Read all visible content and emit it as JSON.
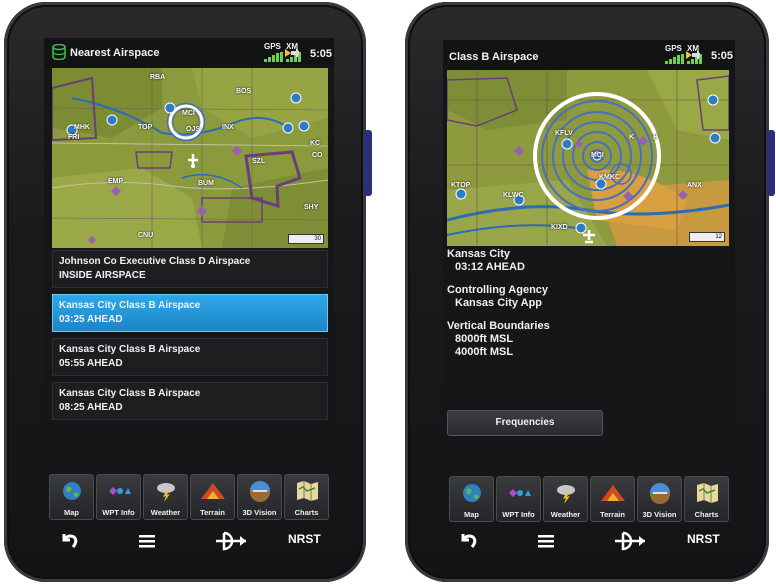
{
  "left": {
    "status": {
      "title": "Nearest Airspace",
      "gps_label": "GPS",
      "xm_label": "XM",
      "time": "5:05"
    },
    "map_labels": {
      "rba": "RBA",
      "bos": "BOS",
      "mhk": "MHK",
      "fri": "FRI",
      "top": "TOP",
      "mci": "MCI",
      "ojs": "OJS",
      "inx": "INX",
      "kc": "KC",
      "co": "CO",
      "szl": "SZL",
      "emp": "EMP",
      "bum": "BUM",
      "shy": "SHY",
      "cnu": "CNU",
      "scale": "30"
    },
    "list": [
      {
        "line1": "Johnson Co Executive Class D Airspace",
        "line2": "INSIDE AIRSPACE"
      },
      {
        "line1": "Kansas City Class B Airspace",
        "line2": "03:25 AHEAD"
      },
      {
        "line1": "Kansas City Class B Airspace",
        "line2": "05:55 AHEAD"
      },
      {
        "line1": "Kansas City Class B Airspace",
        "line2": "08:25 AHEAD"
      }
    ]
  },
  "right": {
    "status": {
      "title": "Class B Airspace",
      "gps_label": "GPS",
      "xm_label": "XM",
      "time": "5:05"
    },
    "map_labels": {
      "kflv": "KFLV",
      "mci": "MCI",
      "kmkc": "KMKC",
      "ktop": "KTOP",
      "klwc": "KLWC",
      "kixd": "KIXD",
      "anx": "ANX",
      "k": "K",
      "h": "H",
      "scale": "12"
    },
    "details": {
      "name": "Kansas City",
      "eta": "03:12 AHEAD",
      "agency_label": "Controlling Agency",
      "agency": "Kansas City App",
      "vb_label": "Vertical Boundaries",
      "ceiling": "8000ft MSL",
      "floor": "4000ft MSL"
    },
    "frequencies_button": "Frequencies"
  },
  "apps": [
    "Map",
    "WPT Info",
    "Weather",
    "Terrain",
    "3D Vision",
    "Charts"
  ],
  "hardware": {
    "nrst": "NRST"
  },
  "colors": {
    "selection": "#2ea8e8",
    "class_b_ring": "#ffffff",
    "airspace_purple": "#7a3f86",
    "map_terrain": "#8a9a3c"
  }
}
